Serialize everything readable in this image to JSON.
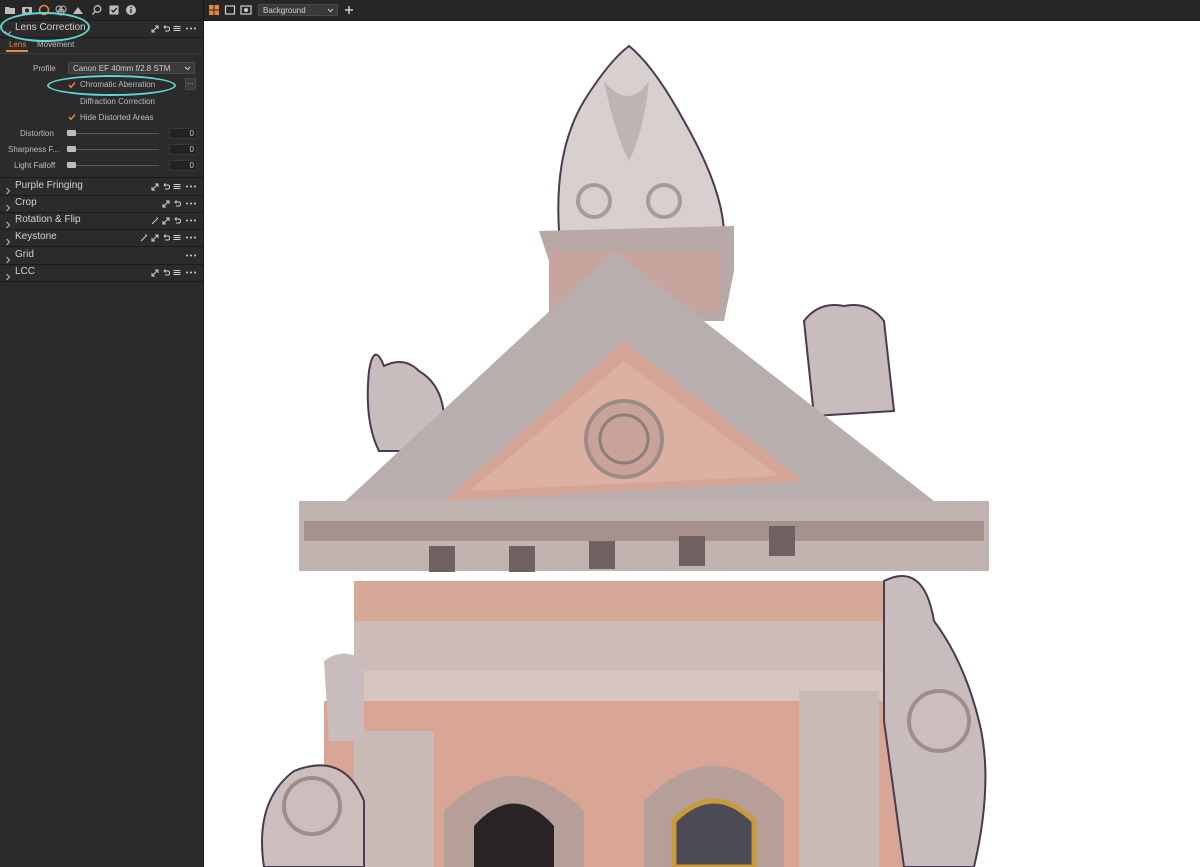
{
  "sidebar": {
    "toolbar_icons": [
      "folder-icon",
      "camera-icon",
      "lens-tool-icon",
      "color-icon",
      "exposure-icon",
      "search-icon",
      "checklist-icon",
      "info-icon"
    ],
    "lens_panel": {
      "title": "Lens Correction",
      "tabs": [
        {
          "label": "Lens"
        },
        {
          "label": "Movement"
        }
      ],
      "profile_label": "Profile",
      "profile_value": "Canon EF 40mm f/2.8 STM",
      "checkboxes": [
        {
          "label": "Chromatic Aberration",
          "checked": true
        },
        {
          "label": "Diffraction Correction",
          "checked": false
        },
        {
          "label": "Hide Distorted Areas",
          "checked": true
        }
      ],
      "more_button": "...",
      "sliders": [
        {
          "label": "Distortion",
          "value": "0"
        },
        {
          "label": "Sharpness F...",
          "value": "0"
        },
        {
          "label": "Light Falloff",
          "value": "0"
        }
      ]
    },
    "collapsed_panels": [
      {
        "title": "Purple Fringing"
      },
      {
        "title": "Crop"
      },
      {
        "title": "Rotation & Flip"
      },
      {
        "title": "Keystone"
      },
      {
        "title": "Grid"
      },
      {
        "title": "LCC"
      }
    ]
  },
  "viewer": {
    "background_select": "Background",
    "image_description_icon": "building-photo"
  },
  "colors": {
    "accent": "#e8893a",
    "highlight": "#5fd6d2",
    "panel_bg": "#2b2b2b"
  }
}
